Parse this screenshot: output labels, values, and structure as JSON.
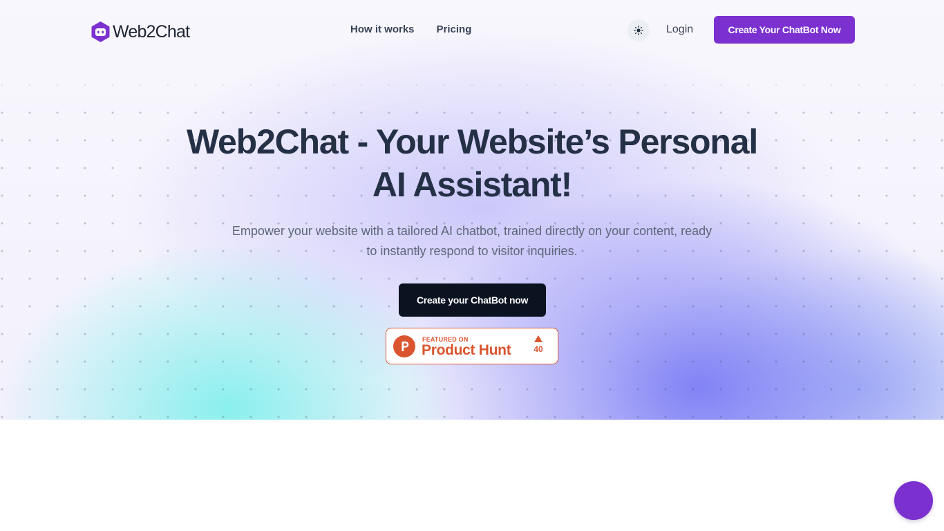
{
  "brand": {
    "name": "Web2Chat",
    "color": "#7b30d0"
  },
  "nav": {
    "links": [
      "How it works",
      "Pricing"
    ],
    "theme_toggle_icon": "sun-icon",
    "login_label": "Login",
    "cta_label": "Create Your ChatBot Now"
  },
  "hero": {
    "headline_line1": "Web2Chat - Your Website’s Personal",
    "headline_line2": "AI Assistant!",
    "subhead_line1": "Empower your website with a tailored AI chatbot, trained directly on your content, ready",
    "subhead_line2": "to instantly respond to visitor inquiries.",
    "cta_label": "Create your ChatBot now"
  },
  "product_hunt": {
    "featured_label": "FEATURED ON",
    "name": "Product Hunt",
    "upvotes": "40",
    "accent": "#da552f"
  },
  "chat_widget": {
    "icon": "chat-launcher-icon",
    "color": "#7b30d0"
  }
}
